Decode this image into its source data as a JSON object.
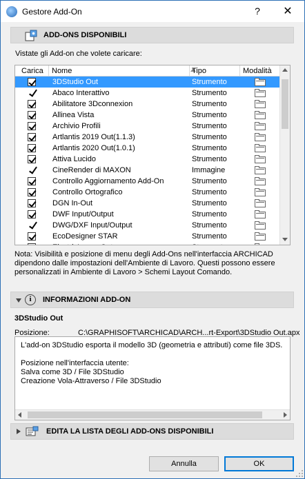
{
  "window": {
    "title": "Gestore Add-On",
    "help_label": "?",
    "close_label": "✕"
  },
  "available": {
    "header": "ADD-ONS DISPONIBILI",
    "instruction": "Vistate gli Add-on che volete caricare:",
    "columns": {
      "load": "Carica",
      "name": "Nome",
      "type": "Tipo",
      "mode": "Modalità"
    },
    "items": [
      {
        "name": "3DStudio Out",
        "type": "Strumento",
        "check": "box",
        "selected": true
      },
      {
        "name": "Abaco Interattivo",
        "type": "Strumento",
        "check": "tick",
        "selected": false
      },
      {
        "name": "Abilitatore 3Dconnexion",
        "type": "Strumento",
        "check": "box",
        "selected": false
      },
      {
        "name": "Allinea Vista",
        "type": "Strumento",
        "check": "box",
        "selected": false
      },
      {
        "name": "Archivio Profili",
        "type": "Strumento",
        "check": "box",
        "selected": false
      },
      {
        "name": "Artlantis 2019 Out(1.1.3)",
        "type": "Strumento",
        "check": "box",
        "selected": false
      },
      {
        "name": "Artlantis 2020 Out(1.0.1)",
        "type": "Strumento",
        "check": "box",
        "selected": false
      },
      {
        "name": "Attiva Lucido",
        "type": "Strumento",
        "check": "box",
        "selected": false
      },
      {
        "name": "CineRender di MAXON",
        "type": "Immagine",
        "check": "tick",
        "selected": false
      },
      {
        "name": "Controllo Aggiornamento Add-On",
        "type": "Strumento",
        "check": "box",
        "selected": false
      },
      {
        "name": "Controllo Ortografico",
        "type": "Strumento",
        "check": "box",
        "selected": false
      },
      {
        "name": "DGN In-Out",
        "type": "Strumento",
        "check": "box",
        "selected": false
      },
      {
        "name": "DWF Input/Output",
        "type": "Strumento",
        "check": "box",
        "selected": false
      },
      {
        "name": "DWG/DXF Input/Output",
        "type": "Strumento",
        "check": "tick",
        "selected": false
      },
      {
        "name": "EcoDesigner STAR",
        "type": "Strumento",
        "check": "box",
        "selected": false
      },
      {
        "name": "ElectricImage Out",
        "type": "Strumento",
        "check": "box",
        "selected": false
      }
    ],
    "note": "Nota: Visibilità e posizione di menu degli Add-Ons nell'interfaccia ARCHICAD dipendono dalle impostazioni dell'Ambiente di Lavoro. Questi possono essere personalizzati in Ambiente di Lavoro > Schemi Layout Comando."
  },
  "info": {
    "header": "INFORMAZIONI ADD-ON",
    "addon_name": "3DStudio Out",
    "position_label": "Posizione:",
    "position_value": "C:\\GRAPHISOFT\\ARCHICAD\\ARCH...rt-Export\\3DStudio Out.apx",
    "description": "L'add-on 3DStudio esporta il modello 3D (geometria e attributi) come file 3DS.\n\nPosizione nell'interfaccia utente:\nSalva come 3D / File 3DStudio\nCreazione Vola-Attraverso / File 3DStudio"
  },
  "edit_list": {
    "header": "EDITA LA LISTA DEGLI ADD-ONS DISPONIBILI"
  },
  "buttons": {
    "cancel": "Annulla",
    "ok": "OK"
  },
  "colors": {
    "selection": "#3399ff",
    "frame": "#2b6fb5",
    "section_bg": "#dcdcdc"
  }
}
